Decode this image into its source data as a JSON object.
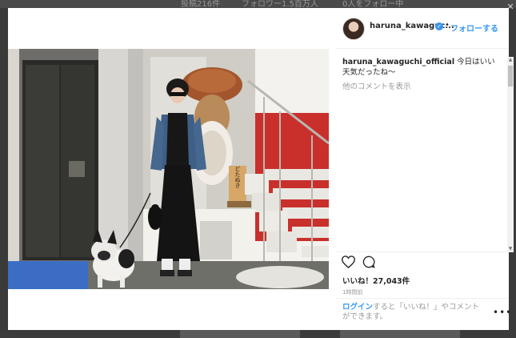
{
  "background_page": {
    "posts_label": "投稿216件",
    "followers_label": "フォロワー1.5百万人",
    "following_label": "0人をフォロー中"
  },
  "post": {
    "username": "haruna_kawaguc...",
    "follow_label": "フォローする",
    "separator": "•",
    "caption_user": "haruna_kawaguchi_official",
    "caption_text": "今日はいい天気だったね〜",
    "view_comments": "他のコメントを表示",
    "likes": "いいね！27,043件",
    "time_ago": "1時間前",
    "login_link": "ログイン",
    "login_prompt": "すると「いいね！」やコメントができます。",
    "sign_text": "どたぬき"
  },
  "icons": {
    "heart": "heart-icon",
    "comment": "comment-icon",
    "verified": "verified-badge-icon",
    "more": "more-options-icon",
    "close": "close-icon"
  },
  "colors": {
    "link_blue": "#3897f0",
    "text_dark": "#262626",
    "text_muted": "#999999",
    "stair_red": "#c9302c"
  }
}
